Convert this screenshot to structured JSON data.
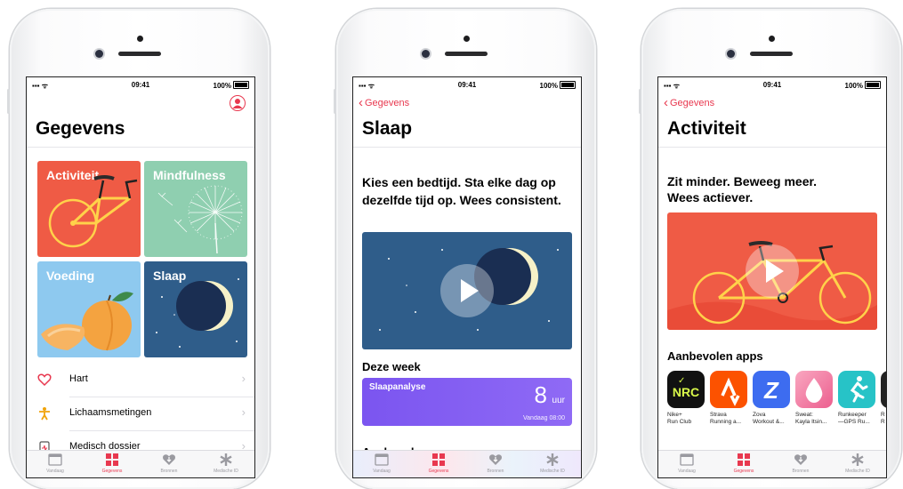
{
  "status": {
    "time": "09:41",
    "battery": "100%",
    "signal": "••ll"
  },
  "tabbar": {
    "items": [
      {
        "label": "Vandaag",
        "icon": "calendar-icon"
      },
      {
        "label": "Gegevens",
        "icon": "grid-icon",
        "active": true
      },
      {
        "label": "Bronnen",
        "icon": "heart-download-icon"
      },
      {
        "label": "Medische ID",
        "icon": "asterisk-icon"
      }
    ]
  },
  "colors": {
    "accent": "#e8384f",
    "activity": "#ef5b45",
    "mindfulness": "#8fcfb0",
    "nutrition": "#8ec9ef",
    "sleep": "#2f5d8a",
    "sleep_card": "#7b55f0"
  },
  "screen1": {
    "title": "Gegevens",
    "tiles": [
      "Activiteit",
      "Mindfulness",
      "Voeding",
      "Slaap"
    ],
    "list": [
      {
        "label": "Hart",
        "icon": "heart-icon"
      },
      {
        "label": "Lichaamsmetingen",
        "icon": "person-icon"
      },
      {
        "label": "Medisch dossier",
        "icon": "clipboard-icon"
      }
    ]
  },
  "screen2": {
    "back": "Gegevens",
    "title": "Slaap",
    "headline": "Kies een bedtijd. Sta elke dag op dezelfde tijd op. Wees consistent.",
    "week_title": "Deze week",
    "card": {
      "title": "Slaapanalyse",
      "value": "8",
      "unit": "uur",
      "date": "Vandaag 08:00"
    },
    "apps_title": "Aanbevolen apps"
  },
  "screen3": {
    "back": "Gegevens",
    "title": "Activiteit",
    "headline": "Zit minder. Beweeg meer. Wees actiever.",
    "apps_title": "Aanbevolen apps",
    "apps": [
      {
        "name": "Nike+\nRun Club",
        "color": "#111111",
        "icon": "nrc-icon",
        "glyph": "NRC"
      },
      {
        "name": "Strava\nRunning a...",
        "color": "#fc5200",
        "icon": "strava-icon"
      },
      {
        "name": "Zova\nWorkout &...",
        "color": "#3d6cf0",
        "icon": "zova-icon",
        "glyph": "Z"
      },
      {
        "name": "Sweat:\nKayla Itsin...",
        "color": "#f47ba0",
        "icon": "sweat-icon"
      },
      {
        "name": "Runkeeper\n—GPS Ru...",
        "color": "#27c3c7",
        "icon": "runner-icon"
      },
      {
        "name": "R\nR",
        "color": "#222222",
        "icon": "app-partial-icon"
      }
    ]
  }
}
